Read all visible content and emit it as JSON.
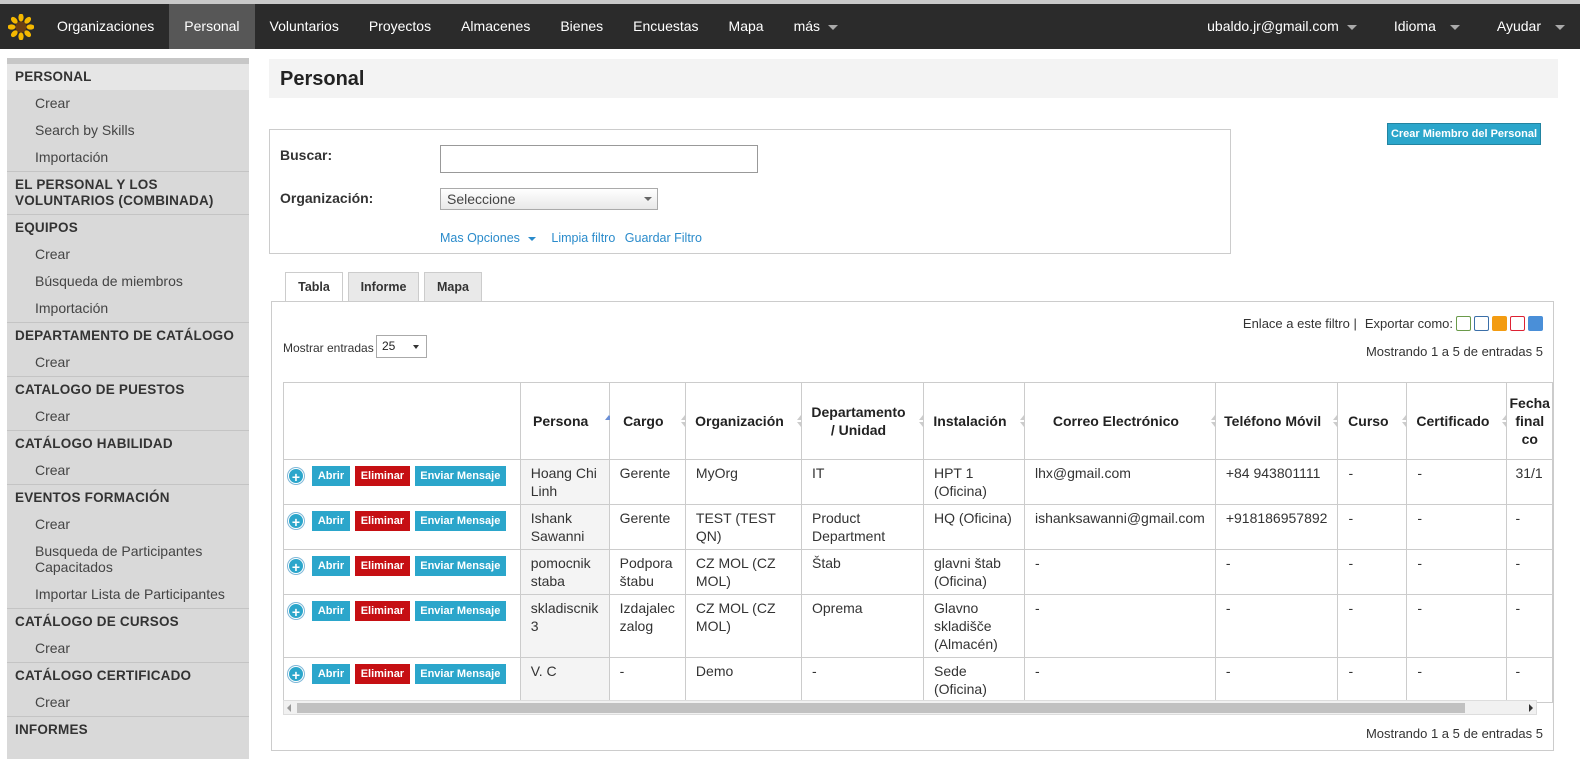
{
  "nav": {
    "items": [
      {
        "label": "Organizaciones",
        "active": false
      },
      {
        "label": "Personal",
        "active": true
      },
      {
        "label": "Voluntarios",
        "active": false
      },
      {
        "label": "Proyectos",
        "active": false
      },
      {
        "label": "Almacenes",
        "active": false
      },
      {
        "label": "Bienes",
        "active": false
      },
      {
        "label": "Encuestas",
        "active": false
      },
      {
        "label": "Mapa",
        "active": false
      },
      {
        "label": "más",
        "active": false
      }
    ],
    "user": "ubaldo.jr@gmail.com",
    "language": "Idioma",
    "help": "Ayudar"
  },
  "sidebar": {
    "sections": [
      {
        "heading": "PERSONAL",
        "items": [
          "Crear",
          "Search by Skills",
          "Importación"
        ]
      },
      {
        "heading": "EL PERSONAL Y LOS VOLUNTARIOS (COMBINADA)",
        "items": []
      },
      {
        "heading": "EQUIPOS",
        "items": [
          "Crear",
          "Búsqueda de miembros",
          "Importación"
        ]
      },
      {
        "heading": "DEPARTAMENTO DE CATÁLOGO",
        "items": [
          "Crear"
        ]
      },
      {
        "heading": "CATALOGO DE PUESTOS",
        "items": [
          "Crear"
        ]
      },
      {
        "heading": "CATÁLOGO HABILIDAD",
        "items": [
          "Crear"
        ]
      },
      {
        "heading": "EVENTOS FORMACIÓN",
        "items": [
          "Crear",
          "Busqueda de Participantes Capacitados",
          "Importar Lista de Participantes"
        ]
      },
      {
        "heading": "CATÁLOGO DE CURSOS",
        "items": [
          "Crear"
        ]
      },
      {
        "heading": "CATÁLOGO CERTIFICADO",
        "items": [
          "Crear"
        ]
      },
      {
        "heading": "INFORMES",
        "items": []
      }
    ]
  },
  "page": {
    "title": "Personal",
    "create_button": "Crear Miembro del Personal"
  },
  "filter": {
    "search_label": "Buscar:",
    "search_value": "",
    "org_label": "Organización:",
    "org_value": "Seleccione",
    "more_options": "Mas Opciones",
    "clear": "Limpia filtro",
    "save": "Guardar Filtro"
  },
  "tabs": [
    {
      "label": "Tabla",
      "active": true
    },
    {
      "label": "Informe",
      "active": false
    },
    {
      "label": "Mapa",
      "active": false
    }
  ],
  "table": {
    "link_filter": "Enlace a este filtro |",
    "export_as": "Exportar como:",
    "export_icons": [
      "xls-icon",
      "xml-icon",
      "rss-icon",
      "pdf-icon",
      "map-icon"
    ],
    "showing_top": "Mostrando 1 a 5 de entradas 5",
    "showing_bottom": "Mostrando 1 a 5 de entradas 5",
    "length_label": "Mostrar entradas",
    "length_value": "25",
    "columns": [
      "Persona",
      "Cargo",
      "Organización",
      "Departamento / Unidad",
      "Instalación",
      "Correo Electrónico",
      "Teléfono Móvil",
      "Curso",
      "Certificado",
      "Fecha final co"
    ],
    "action_labels": {
      "open": "Abrir",
      "delete": "Eliminar",
      "message": "Enviar Mensaje"
    },
    "rows": [
      [
        "Hoang Chi Linh",
        "Gerente",
        "MyOrg",
        "IT",
        "HPT 1 (Oficina)",
        "lhx@gmail.com",
        "+84 943801111",
        "-",
        "-",
        "31/1"
      ],
      [
        "Ishank Sawanni",
        "Gerente",
        "TEST (TEST QN)",
        "Product Department",
        "HQ (Oficina)",
        "ishanksawanni@gmail.com",
        "+918186957892",
        "-",
        "-",
        "-"
      ],
      [
        "pomocnik staba",
        "Podpora štabu",
        "CZ MOL (CZ MOL)",
        "Štab",
        "glavni štab (Oficina)",
        "-",
        "-",
        "-",
        "-",
        "-"
      ],
      [
        "skladiscnik 3",
        "Izdajalec zalog",
        "CZ MOL (CZ MOL)",
        "Oprema",
        "Glavno skladišče (Almacén)",
        "-",
        "-",
        "-",
        "-",
        "-"
      ],
      [
        "V. C",
        "-",
        "Demo",
        "-",
        "Sede (Oficina)",
        "-",
        "-",
        "-",
        "-",
        "-"
      ]
    ]
  },
  "colors": {
    "topbar": "#2b2b2b",
    "button_blue": "#2ba6cb",
    "button_red": "#c60f13",
    "link_blue": "#2a8bcb"
  }
}
